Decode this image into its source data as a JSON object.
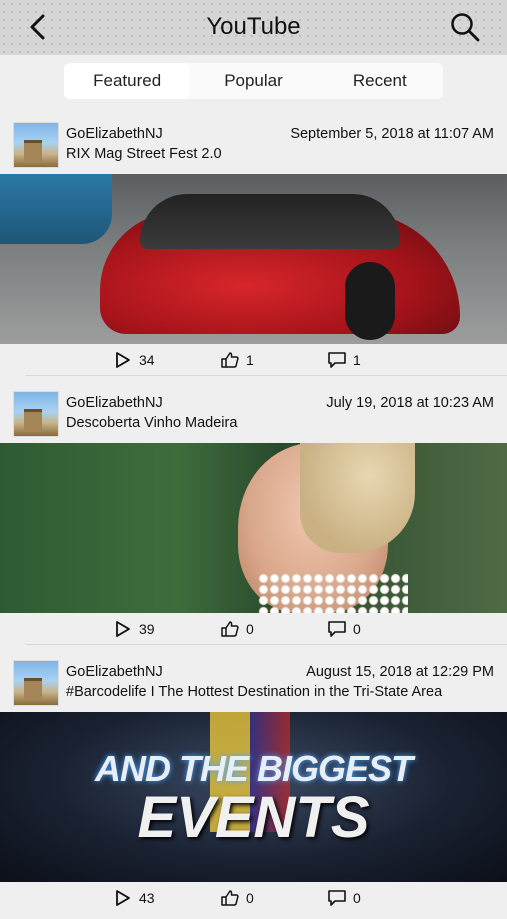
{
  "header": {
    "title": "YouTube",
    "back_icon": "chevron-left-icon",
    "search_icon": "search-icon"
  },
  "tabs": [
    {
      "label": "Featured",
      "active": true
    },
    {
      "label": "Popular",
      "active": false
    },
    {
      "label": "Recent",
      "active": false
    }
  ],
  "posts": [
    {
      "channel": "GoElizabethNJ",
      "date": "September 5, 2018 at 11:07 AM",
      "title": "RIX Mag Street Fest 2.0",
      "views": "34",
      "likes": "1",
      "comments": "1"
    },
    {
      "channel": "GoElizabethNJ",
      "date": "July 19, 2018 at 10:23 AM",
      "title": "Descoberta Vinho Madeira",
      "views": "39",
      "likes": "0",
      "comments": "0"
    },
    {
      "channel": "GoElizabethNJ",
      "date": "August 15, 2018 at 12:29 PM",
      "title": "#Barcodelife I The Hottest Destination in the Tri-State Area",
      "thumb_text_1": "AND THE BIGGEST",
      "thumb_text_2": "EVENTS",
      "views": "43",
      "likes": "0",
      "comments": "0"
    }
  ],
  "colors": {
    "header_bg": "#d6d6d6",
    "page_bg": "#efefef"
  }
}
